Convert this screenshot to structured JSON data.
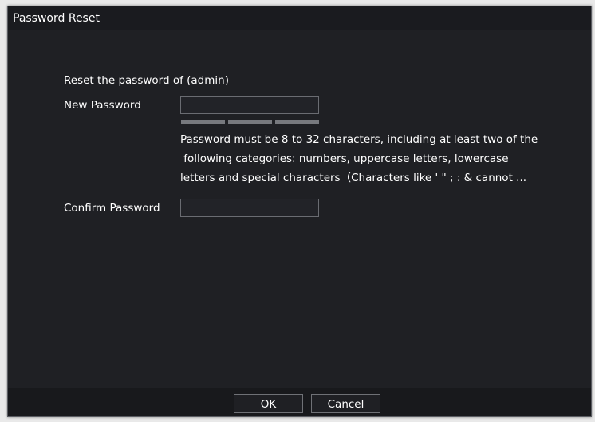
{
  "dialog": {
    "title": "Password Reset",
    "heading": "Reset the password of (admin)"
  },
  "form": {
    "new_password": {
      "label": "New Password",
      "value": "",
      "placeholder": ""
    },
    "strength": {
      "segments": 3,
      "filled": 0
    },
    "hint_lines": [
      "Password must be 8 to 32 characters, including at least two of the",
      " following categories: numbers, uppercase letters, lowercase",
      "letters and special characters（Characters like ' \" ; : & cannot ..."
    ],
    "confirm_password": {
      "label": "Confirm Password",
      "value": "",
      "placeholder": ""
    }
  },
  "buttons": {
    "ok": "OK",
    "cancel": "Cancel"
  },
  "colors": {
    "dialog_bg": "#1f2024",
    "text": "#ffffff",
    "border": "#6a6c72",
    "strength_bar": "#77797e"
  }
}
